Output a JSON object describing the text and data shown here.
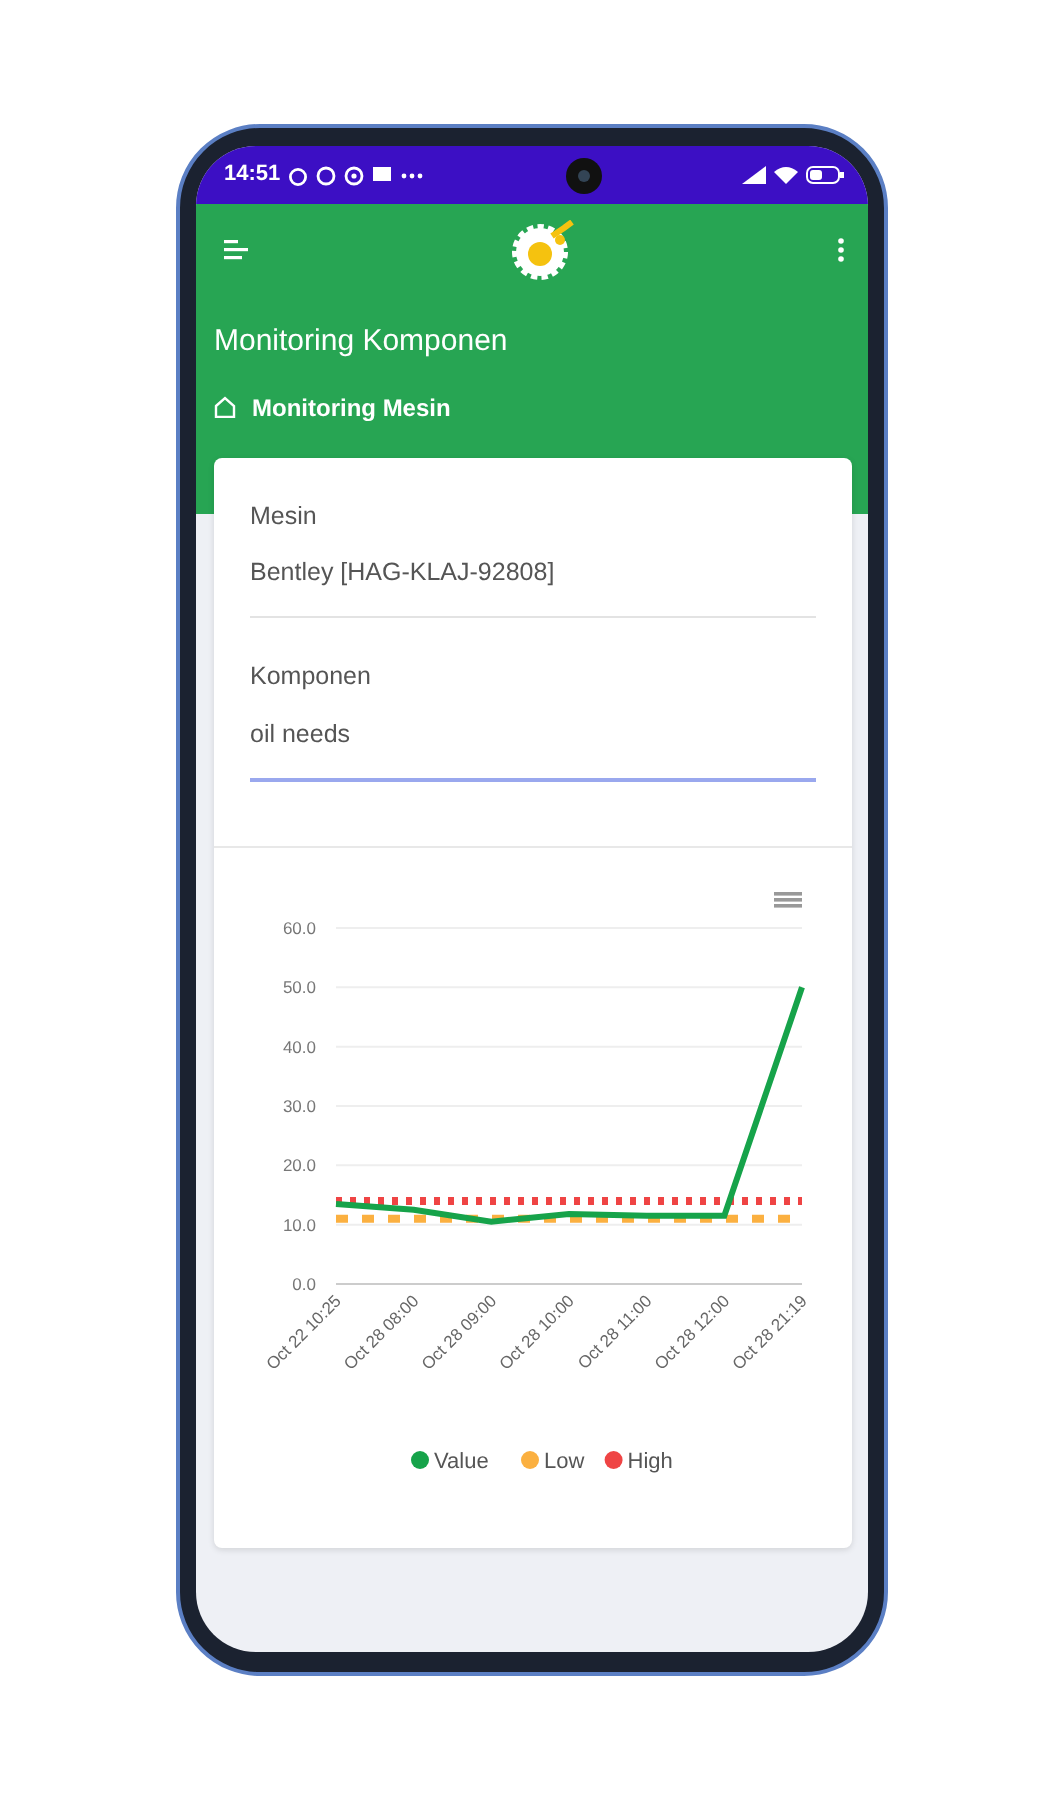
{
  "status_bar": {
    "time": "14:51"
  },
  "app_bar": {
    "title": "Monitoring Komponen",
    "breadcrumb": "Monitoring Mesin"
  },
  "form": {
    "fields": [
      {
        "label": "Mesin",
        "value": "Bentley [HAG-KLAJ-92808]",
        "focused": false
      },
      {
        "label": "Komponen",
        "value": "oil needs",
        "focused": true
      }
    ]
  },
  "chart": {
    "chart_data": {
      "type": "line",
      "categories": [
        "Oct 22 10:25",
        "Oct 28 08:00",
        "Oct 28 09:00",
        "Oct 28 10:00",
        "Oct 28 11:00",
        "Oct 28 12:00",
        "Oct 28 21:19"
      ],
      "series": [
        {
          "name": "Value",
          "color": "#16a34a",
          "line_style": "solid",
          "values": [
            13.5,
            12.5,
            10.5,
            11.8,
            11.5,
            11.5,
            50
          ]
        },
        {
          "name": "Low",
          "color": "#fbb040",
          "line_style": "dashed",
          "values": [
            11,
            11,
            11,
            11,
            11,
            11,
            11
          ]
        },
        {
          "name": "High",
          "color": "#ef4444",
          "line_style": "dotted",
          "values": [
            14,
            14,
            14,
            14,
            14,
            14,
            14
          ]
        }
      ],
      "ylim": [
        0,
        60
      ],
      "grid": true,
      "legend": true,
      "yticks": [
        {
          "value": 0,
          "label": "0.0"
        },
        {
          "value": 10,
          "label": "10.0"
        },
        {
          "value": 20,
          "label": "20.0"
        },
        {
          "value": 30,
          "label": "30.0"
        },
        {
          "value": 40,
          "label": "40.0"
        },
        {
          "value": 50,
          "label": "50.0"
        },
        {
          "value": 60,
          "label": "60.0"
        }
      ]
    }
  }
}
